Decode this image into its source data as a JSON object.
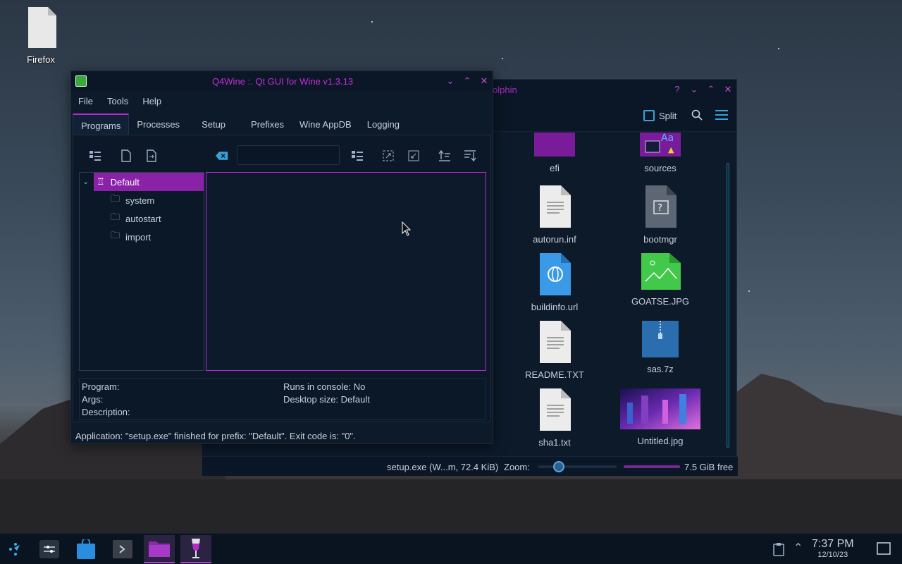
{
  "desktop": {
    "icons": [
      {
        "label": "Firefox"
      }
    ]
  },
  "dolphin": {
    "title": "olphin",
    "toolbar": {
      "split_label": "Split"
    },
    "files": [
      {
        "name": "efi",
        "icon": "folder-icon"
      },
      {
        "name": "sources",
        "icon": "folder-icon"
      },
      {
        "name": "autorun.inf",
        "icon": "text-file-icon"
      },
      {
        "name": "bootmgr",
        "icon": "unknown-file-icon"
      },
      {
        "name": "buildinfo.url",
        "icon": "url-file-icon"
      },
      {
        "name": "GOATSE.JPG",
        "icon": "image-file-icon"
      },
      {
        "name": "README.TXT",
        "icon": "text-file-icon"
      },
      {
        "name": "sas.7z",
        "icon": "archive-file-icon"
      },
      {
        "name": "sha1.txt",
        "icon": "text-file-icon"
      },
      {
        "name": "Untitled.jpg",
        "icon": "image-thumbnail"
      }
    ],
    "status": {
      "selection": "setup.exe (W...m, 72.4 KiB)",
      "zoom_label": "Zoom:",
      "free_space": "7.5 GiB free"
    }
  },
  "q4wine": {
    "title": "Q4Wine :. Qt GUI for Wine v1.3.13",
    "menu": [
      "File",
      "Tools",
      "Help"
    ],
    "tabs": [
      "Programs",
      "Processes",
      "Setup",
      "Prefixes",
      "Wine AppDB",
      "Logging"
    ],
    "active_tab": "Programs",
    "tree": {
      "root": "Default",
      "children": [
        "system",
        "autostart",
        "import"
      ]
    },
    "info": {
      "program": "Program:",
      "args": "Args:",
      "description": "Description:",
      "console": "Runs in console: No",
      "desktop": "Desktop size: Default"
    },
    "status": "Application: \"setup.exe\" finished for prefix: \"Default\". Exit code is: \"0\"."
  },
  "taskbar": {
    "clock": {
      "time": "7:37 PM",
      "date": "12/10/23"
    }
  },
  "colors": {
    "accent": "#b42ad0",
    "window_bg": "#0d1a2a",
    "highlight": "#8a22a8"
  }
}
